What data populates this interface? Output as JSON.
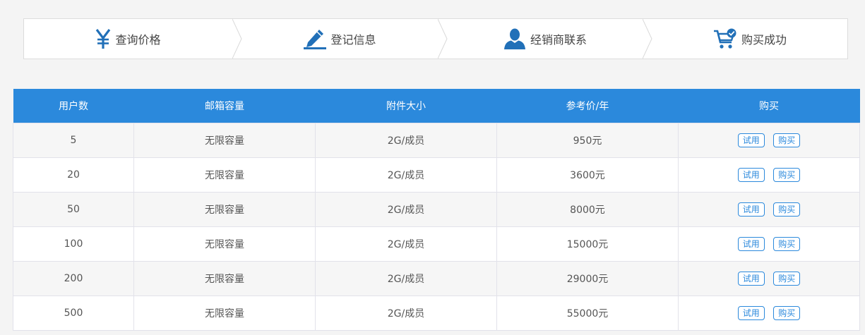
{
  "colors": {
    "accent": "#2b89dc",
    "icon": "#2170b8",
    "header_text": "#ffffff",
    "row_alt": "#f6f6f6",
    "page_bg": "#f4f4f4"
  },
  "steps": [
    {
      "icon": "yen-icon",
      "label": "查询价格"
    },
    {
      "icon": "pencil-icon",
      "label": "登记信息"
    },
    {
      "icon": "user-icon",
      "label": "经销商联系"
    },
    {
      "icon": "cart-check-icon",
      "label": "购买成功"
    }
  ],
  "table": {
    "headers": [
      "用户数",
      "邮箱容量",
      "附件大小",
      "参考价/年",
      "购买"
    ],
    "rows": [
      {
        "users": "5",
        "capacity": "无限容量",
        "attachment": "2G/成员",
        "price": "950元",
        "trial_label": "试用",
        "buy_label": "购买"
      },
      {
        "users": "20",
        "capacity": "无限容量",
        "attachment": "2G/成员",
        "price": "3600元",
        "trial_label": "试用",
        "buy_label": "购买"
      },
      {
        "users": "50",
        "capacity": "无限容量",
        "attachment": "2G/成员",
        "price": "8000元",
        "trial_label": "试用",
        "buy_label": "购买"
      },
      {
        "users": "100",
        "capacity": "无限容量",
        "attachment": "2G/成员",
        "price": "15000元",
        "trial_label": "试用",
        "buy_label": "购买"
      },
      {
        "users": "200",
        "capacity": "无限容量",
        "attachment": "2G/成员",
        "price": "29000元",
        "trial_label": "试用",
        "buy_label": "购买"
      },
      {
        "users": "500",
        "capacity": "无限容量",
        "attachment": "2G/成员",
        "price": "55000元",
        "trial_label": "试用",
        "buy_label": "购买"
      }
    ]
  }
}
